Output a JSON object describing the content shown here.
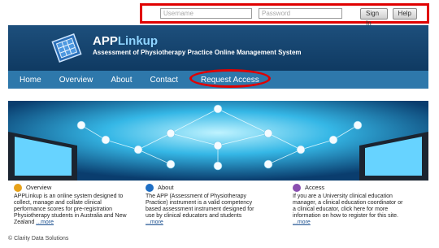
{
  "login": {
    "username_placeholder": "Username",
    "password_placeholder": "Password",
    "signin_label": "Sign In",
    "help_label": "Help"
  },
  "header": {
    "title_part1": "APP",
    "title_part2": "Linkup",
    "subtitle": "Assessment of Physiotherapy Practice Online Management System"
  },
  "nav": {
    "items": [
      "Home",
      "Overview",
      "About",
      "Contact",
      "Request Access"
    ]
  },
  "columns": [
    {
      "icon": "star-icon",
      "color": "#e8a21a",
      "title": "Overview",
      "body": "APPLinkup is an online system designed to collect, manage and collate clinical performance scores for pre-registration Physiotherapy students in Australia and New Zealand",
      "more": "...more"
    },
    {
      "icon": "info-icon",
      "color": "#1f6fc5",
      "title": "About",
      "body": "The APP (Assessment of Physiotherapy Practice) instrument is a valid competency based assessment instrument designed for use by clinical educators and students",
      "more": "...more"
    },
    {
      "icon": "key-icon",
      "color": "#8a4fb0",
      "title": "Access",
      "body": "If you are a University clinical education manager, a clinical education coordinator or a clinical educator, click here for more information on how to register for this site.",
      "more": "...more"
    }
  ],
  "footer": {
    "text": "© Clarity Data Solutions"
  },
  "colors": {
    "header": "#1d4f7c",
    "nav": "#2e78ab",
    "highlight": "#e00000"
  }
}
